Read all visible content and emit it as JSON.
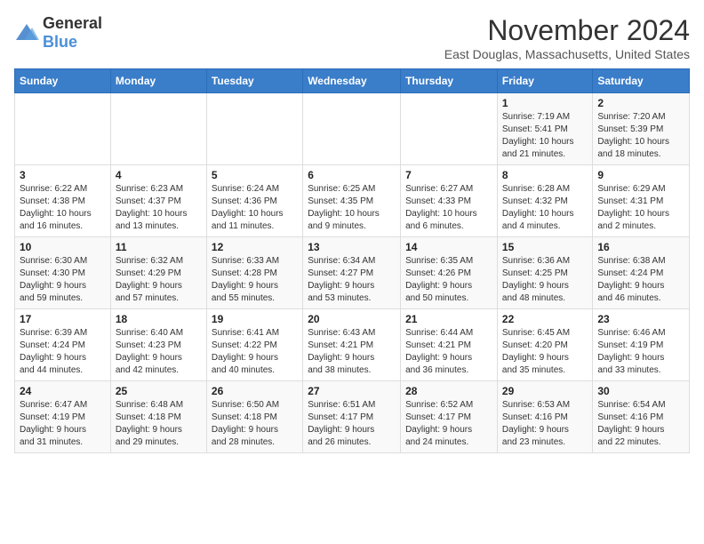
{
  "logo": {
    "general": "General",
    "blue": "Blue"
  },
  "title": "November 2024",
  "subtitle": "East Douglas, Massachusetts, United States",
  "days_header": [
    "Sunday",
    "Monday",
    "Tuesday",
    "Wednesday",
    "Thursday",
    "Friday",
    "Saturday"
  ],
  "weeks": [
    [
      {
        "day": "",
        "info": ""
      },
      {
        "day": "",
        "info": ""
      },
      {
        "day": "",
        "info": ""
      },
      {
        "day": "",
        "info": ""
      },
      {
        "day": "",
        "info": ""
      },
      {
        "day": "1",
        "info": "Sunrise: 7:19 AM\nSunset: 5:41 PM\nDaylight: 10 hours\nand 21 minutes."
      },
      {
        "day": "2",
        "info": "Sunrise: 7:20 AM\nSunset: 5:39 PM\nDaylight: 10 hours\nand 18 minutes."
      }
    ],
    [
      {
        "day": "3",
        "info": "Sunrise: 6:22 AM\nSunset: 4:38 PM\nDaylight: 10 hours\nand 16 minutes."
      },
      {
        "day": "4",
        "info": "Sunrise: 6:23 AM\nSunset: 4:37 PM\nDaylight: 10 hours\nand 13 minutes."
      },
      {
        "day": "5",
        "info": "Sunrise: 6:24 AM\nSunset: 4:36 PM\nDaylight: 10 hours\nand 11 minutes."
      },
      {
        "day": "6",
        "info": "Sunrise: 6:25 AM\nSunset: 4:35 PM\nDaylight: 10 hours\nand 9 minutes."
      },
      {
        "day": "7",
        "info": "Sunrise: 6:27 AM\nSunset: 4:33 PM\nDaylight: 10 hours\nand 6 minutes."
      },
      {
        "day": "8",
        "info": "Sunrise: 6:28 AM\nSunset: 4:32 PM\nDaylight: 10 hours\nand 4 minutes."
      },
      {
        "day": "9",
        "info": "Sunrise: 6:29 AM\nSunset: 4:31 PM\nDaylight: 10 hours\nand 2 minutes."
      }
    ],
    [
      {
        "day": "10",
        "info": "Sunrise: 6:30 AM\nSunset: 4:30 PM\nDaylight: 9 hours\nand 59 minutes."
      },
      {
        "day": "11",
        "info": "Sunrise: 6:32 AM\nSunset: 4:29 PM\nDaylight: 9 hours\nand 57 minutes."
      },
      {
        "day": "12",
        "info": "Sunrise: 6:33 AM\nSunset: 4:28 PM\nDaylight: 9 hours\nand 55 minutes."
      },
      {
        "day": "13",
        "info": "Sunrise: 6:34 AM\nSunset: 4:27 PM\nDaylight: 9 hours\nand 53 minutes."
      },
      {
        "day": "14",
        "info": "Sunrise: 6:35 AM\nSunset: 4:26 PM\nDaylight: 9 hours\nand 50 minutes."
      },
      {
        "day": "15",
        "info": "Sunrise: 6:36 AM\nSunset: 4:25 PM\nDaylight: 9 hours\nand 48 minutes."
      },
      {
        "day": "16",
        "info": "Sunrise: 6:38 AM\nSunset: 4:24 PM\nDaylight: 9 hours\nand 46 minutes."
      }
    ],
    [
      {
        "day": "17",
        "info": "Sunrise: 6:39 AM\nSunset: 4:24 PM\nDaylight: 9 hours\nand 44 minutes."
      },
      {
        "day": "18",
        "info": "Sunrise: 6:40 AM\nSunset: 4:23 PM\nDaylight: 9 hours\nand 42 minutes."
      },
      {
        "day": "19",
        "info": "Sunrise: 6:41 AM\nSunset: 4:22 PM\nDaylight: 9 hours\nand 40 minutes."
      },
      {
        "day": "20",
        "info": "Sunrise: 6:43 AM\nSunset: 4:21 PM\nDaylight: 9 hours\nand 38 minutes."
      },
      {
        "day": "21",
        "info": "Sunrise: 6:44 AM\nSunset: 4:21 PM\nDaylight: 9 hours\nand 36 minutes."
      },
      {
        "day": "22",
        "info": "Sunrise: 6:45 AM\nSunset: 4:20 PM\nDaylight: 9 hours\nand 35 minutes."
      },
      {
        "day": "23",
        "info": "Sunrise: 6:46 AM\nSunset: 4:19 PM\nDaylight: 9 hours\nand 33 minutes."
      }
    ],
    [
      {
        "day": "24",
        "info": "Sunrise: 6:47 AM\nSunset: 4:19 PM\nDaylight: 9 hours\nand 31 minutes."
      },
      {
        "day": "25",
        "info": "Sunrise: 6:48 AM\nSunset: 4:18 PM\nDaylight: 9 hours\nand 29 minutes."
      },
      {
        "day": "26",
        "info": "Sunrise: 6:50 AM\nSunset: 4:18 PM\nDaylight: 9 hours\nand 28 minutes."
      },
      {
        "day": "27",
        "info": "Sunrise: 6:51 AM\nSunset: 4:17 PM\nDaylight: 9 hours\nand 26 minutes."
      },
      {
        "day": "28",
        "info": "Sunrise: 6:52 AM\nSunset: 4:17 PM\nDaylight: 9 hours\nand 24 minutes."
      },
      {
        "day": "29",
        "info": "Sunrise: 6:53 AM\nSunset: 4:16 PM\nDaylight: 9 hours\nand 23 minutes."
      },
      {
        "day": "30",
        "info": "Sunrise: 6:54 AM\nSunset: 4:16 PM\nDaylight: 9 hours\nand 22 minutes."
      }
    ]
  ]
}
